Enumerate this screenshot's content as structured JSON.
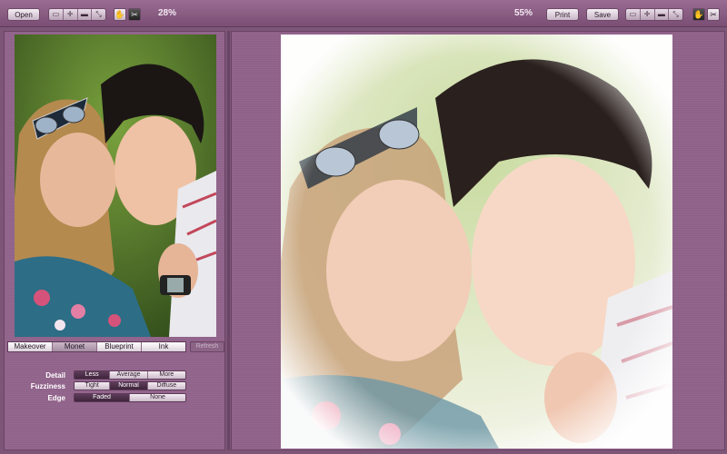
{
  "toolbar": {
    "open_label": "Open",
    "left_zoom": "28%",
    "right_zoom": "55%",
    "print_label": "Print",
    "save_label": "Save"
  },
  "styles": {
    "tabs": [
      "Makeover",
      "Monet",
      "Blueprint",
      "Ink"
    ],
    "selected": "Monet",
    "refresh_label": "Refresh"
  },
  "settings": {
    "detail": {
      "label": "Detail",
      "options": [
        "Less",
        "Average",
        "More"
      ],
      "selected": "Less"
    },
    "fuzziness": {
      "label": "Fuzziness",
      "options": [
        "Tight",
        "Normal",
        "Diffuse"
      ],
      "selected": "Normal"
    },
    "edge": {
      "label": "Edge",
      "options": [
        "Faded",
        "None"
      ],
      "selected": "Faded"
    }
  },
  "colors": {
    "frame": "#7d5577",
    "panel": "#93668d",
    "selected_option": "#4a2e46"
  }
}
